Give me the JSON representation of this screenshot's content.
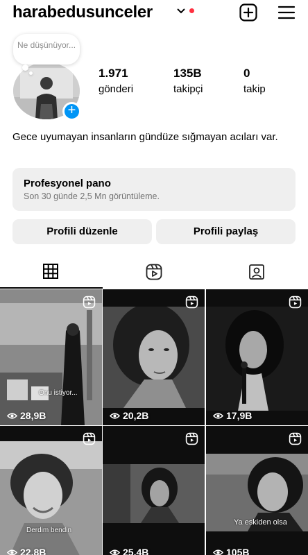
{
  "header": {
    "username": "harabedusunceler",
    "icons": {
      "chevron": "chevron-down-icon",
      "add": "plus-square-icon",
      "menu": "hamburger-icon"
    },
    "live_dot_color": "#ff3040"
  },
  "profile": {
    "note_text": "Ne düşünüyor...",
    "add_story_glyph": "+",
    "accent_color": "#0095f6",
    "stats": [
      {
        "value": "1.971",
        "label": "gönderi"
      },
      {
        "value": "135B",
        "label": "takipçi"
      },
      {
        "value": "0",
        "label": "takip"
      }
    ],
    "bio": "Gece uyumayan insanların gündüze sığmayan acıları var."
  },
  "pro_dashboard": {
    "title": "Profesyonel pano",
    "subtitle": "Son 30 günde 2,5 Mn görüntüleme."
  },
  "actions": {
    "edit_label": "Profili düzenle",
    "share_label": "Profili paylaş"
  },
  "tabs": [
    {
      "icon": "grid-icon",
      "active": true
    },
    {
      "icon": "reels-icon",
      "active": false
    },
    {
      "icon": "tagged-icon",
      "active": false
    }
  ],
  "posts": [
    {
      "views": "28,9B",
      "caption": "Onu istiyor..."
    },
    {
      "views": "20,2B",
      "caption": ""
    },
    {
      "views": "17,9B",
      "caption": ""
    },
    {
      "views": "22,8B",
      "caption": "Derdim bendin"
    },
    {
      "views": "25,4B",
      "caption": ""
    },
    {
      "views": "105B",
      "caption": "Ya eskiden olsa"
    }
  ]
}
